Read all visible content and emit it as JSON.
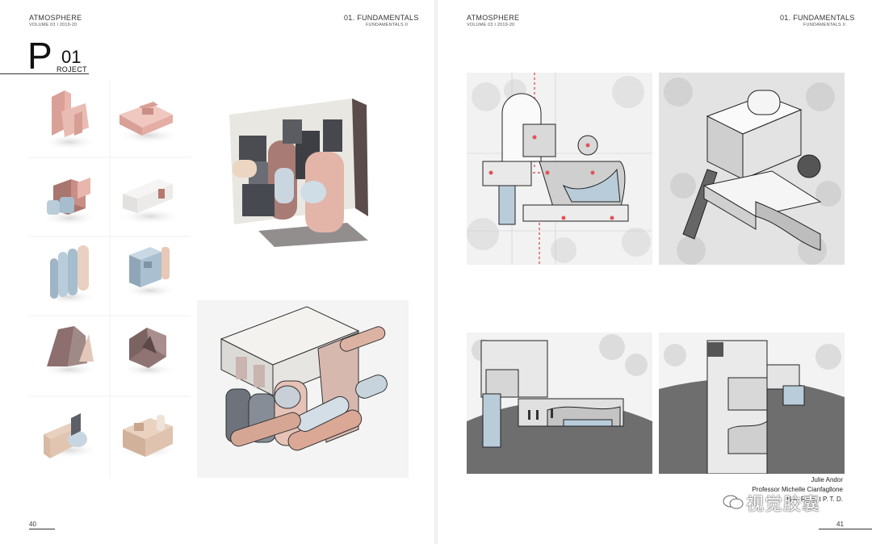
{
  "left_page": {
    "header_title": "ATMOSPHERE",
    "header_volume": "VOLUME 03  I  2019-20",
    "section_title": "01. FUNDAMENTALS",
    "section_sub": "FUNDAMENTALS II",
    "project_letter": "P",
    "project_number": "01",
    "project_word_rest": "ROJECT",
    "page_number": "40"
  },
  "right_page": {
    "header_title": "ATMOSPHERE",
    "header_volume": "VOLUME 03  I  2019-20",
    "section_title": "01. FUNDAMENTALS",
    "section_sub": "FUNDAMENTALS II",
    "page_number": "41",
    "credits": [
      "Julie Andor",
      "Professor Michelle Cianfagllone",
      "B.A.  F.I.  S.  t  P.  T.  D."
    ]
  },
  "watermark": "视觉胶囊",
  "colors": {
    "pink": "#e8b6ad",
    "blue": "#b9ccd9",
    "mauve": "#a08a88",
    "tan": "#dcc3ad",
    "white": "#f1f0ee",
    "dark": "#555a60",
    "gray": "#7a7a7a",
    "accent": "#e0545b"
  }
}
